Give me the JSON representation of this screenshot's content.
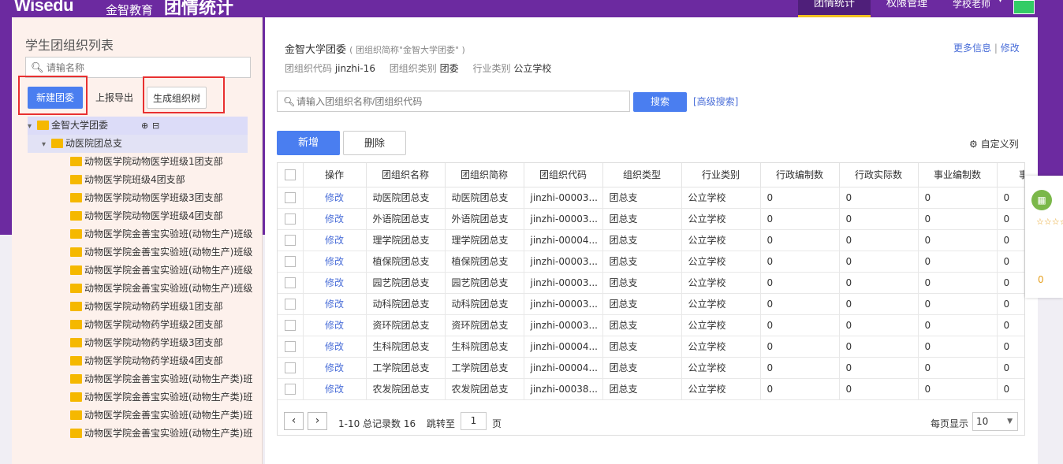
{
  "header": {
    "logo": "Wisedu",
    "logo_cn": "金智教育",
    "app_title": "团情统计",
    "tabs": [
      {
        "label": "团情统计"
      },
      {
        "label": "权限管理"
      }
    ],
    "user_label": "学校老师",
    "colors": {
      "brand": "#6c2aa0",
      "accent": "#4a7ef0"
    }
  },
  "sidebar": {
    "title": "学生团组织列表",
    "search_placeholder": "请输名称",
    "new_button": "新建团委",
    "export_button": "上报导出",
    "tree_button": "生成组织树",
    "root": "金智大学团委",
    "branch": "动医院团总支",
    "items": [
      "动物医学院动物医学班级1团支部",
      "动物医学院班级4团支部",
      "动物医学院动物医学班级3团支部",
      "动物医学院动物医学班级4团支部",
      "动物医学院金善宝实验班(动物生产)班级",
      "动物医学院金善宝实验班(动物生产)班级",
      "动物医学院金善宝实验班(动物生产)班级",
      "动物医学院金善宝实验班(动物生产)班级",
      "动物医学院动物药学班级1团支部",
      "动物医学院动物药学班级2团支部",
      "动物医学院动物药学班级3团支部",
      "动物医学院动物药学班级4团支部",
      "动物医学院金善宝实验班(动物生产类)班",
      "动物医学院金善宝实验班(动物生产类)班",
      "动物医学院金善宝实验班(动物生产类)班",
      "动物医学院金善宝实验班(动物生产类)班"
    ]
  },
  "main": {
    "org_name": "金智大学团委",
    "org_short": "( 团组织简称\"金智大学团委\" )",
    "code_label": "团组织代码",
    "code_value": "jinzhi-16",
    "type_label": "团组织类别",
    "type_value": "团委",
    "industry_label": "行业类别",
    "industry_value": "公立学校",
    "more_info": "更多信息",
    "edit_link": "修改",
    "search_placeholder": "请输入团组织名称/团组织代码",
    "search_button": "搜索",
    "advanced_search": "[高级搜索]",
    "add_button": "新增",
    "delete_button": "删除",
    "customize_columns": "自定义列",
    "columns": [
      "操作",
      "团组织名称",
      "团组织简称",
      "团组织代码",
      "组织类型",
      "行业类别",
      "行政编制数",
      "行政实际数",
      "事业编制数",
      "事"
    ],
    "rows": [
      [
        "修改",
        "动医院团总支",
        "动医院团总支",
        "jinzhi-00003...",
        "团总支",
        "公立学校",
        "0",
        "0",
        "0",
        "0"
      ],
      [
        "修改",
        "外语院团总支",
        "外语院团总支",
        "jinzhi-00003...",
        "团总支",
        "公立学校",
        "0",
        "0",
        "0",
        "0"
      ],
      [
        "修改",
        "理学院团总支",
        "理学院团总支",
        "jinzhi-00004...",
        "团总支",
        "公立学校",
        "0",
        "0",
        "0",
        "0"
      ],
      [
        "修改",
        "植保院团总支",
        "植保院团总支",
        "jinzhi-00003...",
        "团总支",
        "公立学校",
        "0",
        "0",
        "0",
        "0"
      ],
      [
        "修改",
        "园艺院团总支",
        "园艺院团总支",
        "jinzhi-00003...",
        "团总支",
        "公立学校",
        "0",
        "0",
        "0",
        "0"
      ],
      [
        "修改",
        "动科院团总支",
        "动科院团总支",
        "jinzhi-00003...",
        "团总支",
        "公立学校",
        "0",
        "0",
        "0",
        "0"
      ],
      [
        "修改",
        "资环院团总支",
        "资环院团总支",
        "jinzhi-00003...",
        "团总支",
        "公立学校",
        "0",
        "0",
        "0",
        "0"
      ],
      [
        "修改",
        "生科院团总支",
        "生科院团总支",
        "jinzhi-00004...",
        "团总支",
        "公立学校",
        "0",
        "0",
        "0",
        "0"
      ],
      [
        "修改",
        "工学院团总支",
        "工学院团总支",
        "jinzhi-00004...",
        "团总支",
        "公立学校",
        "0",
        "0",
        "0",
        "0"
      ],
      [
        "修改",
        "农发院团总支",
        "农发院团总支",
        "jinzhi-00038...",
        "团总支",
        "公立学校",
        "0",
        "0",
        "0",
        "0"
      ]
    ],
    "pager": {
      "range": "1-10 总记录数 16",
      "jump_label": "跳转至",
      "page": "1",
      "page_unit": "页",
      "per_page_label": "每页显示",
      "per_page": "10"
    }
  },
  "widget": {
    "stars": "☆☆☆☆☆",
    "count": "0"
  }
}
